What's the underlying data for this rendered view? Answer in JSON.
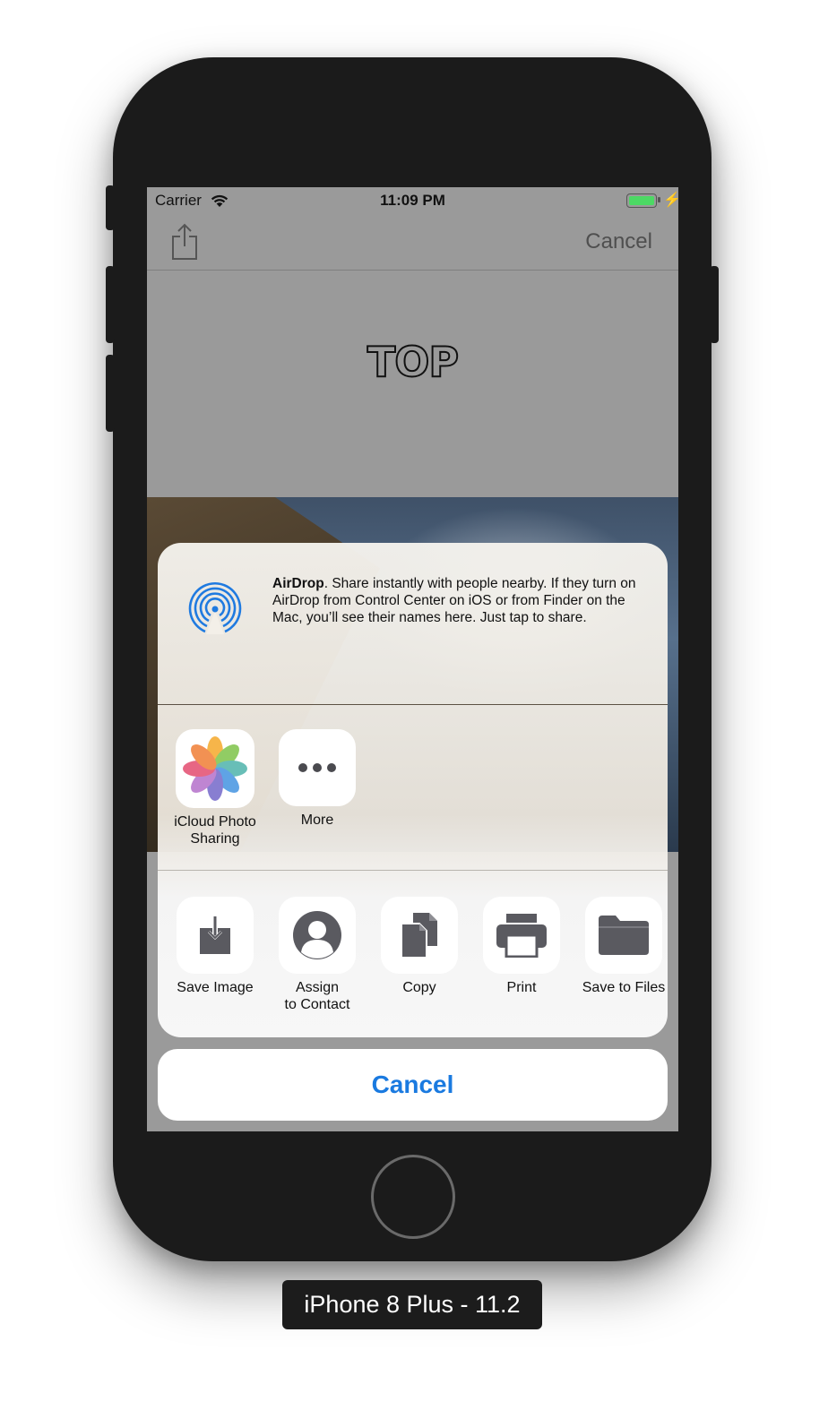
{
  "device_label": "iPhone 8 Plus - 11.2",
  "status_bar": {
    "carrier": "Carrier",
    "time": "11:09 PM",
    "battery_color": "#4cd964"
  },
  "nav_bar": {
    "share_icon": "share-icon",
    "cancel_label": "Cancel"
  },
  "content": {
    "title": "TOP"
  },
  "share_sheet": {
    "airdrop": {
      "title": "AirDrop",
      "description": ". Share instantly with people nearby. If they turn on AirDrop from Control Center on iOS or from Finder on the Mac, you’ll see their names here. Just tap to share."
    },
    "apps": [
      {
        "label": "iCloud Photo\nSharing",
        "icon": "photos-icon"
      },
      {
        "label": "More",
        "icon": "more-icon"
      }
    ],
    "actions": [
      {
        "label": "Save Image",
        "icon": "save-image-icon"
      },
      {
        "label": "Assign\nto Contact",
        "icon": "contact-icon"
      },
      {
        "label": "Copy",
        "icon": "copy-icon"
      },
      {
        "label": "Print",
        "icon": "print-icon"
      },
      {
        "label": "Save to Files",
        "icon": "folder-icon"
      }
    ],
    "cancel_label": "Cancel",
    "accent_color": "#1a7ae0"
  }
}
